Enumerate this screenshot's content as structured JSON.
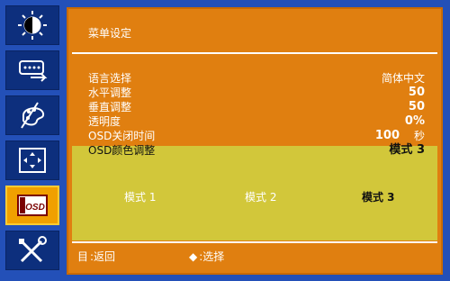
{
  "menu": {
    "title": "菜单设定",
    "rows": [
      {
        "label": "语言选择",
        "value": "简体中文"
      },
      {
        "label": "水平调整",
        "value": "50"
      },
      {
        "label": "垂直调整",
        "value": "50"
      },
      {
        "label": "透明度",
        "value": "0%"
      },
      {
        "label": "OSD关闭时间",
        "value": "100",
        "unit": "秒"
      },
      {
        "label": "OSD颜色调整",
        "value": "模式 3"
      }
    ],
    "modes": [
      "模式 1",
      "模式 2",
      "模式 3"
    ],
    "selected_mode": "模式 3"
  },
  "footer": {
    "back_glyph": "目",
    "back_label": ":返回",
    "select_glyph": "◆",
    "select_label": ":选择"
  },
  "sidebar": {
    "items": [
      {
        "icon": "brightness-icon"
      },
      {
        "icon": "input-source-icon"
      },
      {
        "icon": "color-palette-icon"
      },
      {
        "icon": "image-position-icon"
      },
      {
        "icon": "osd-settings-icon",
        "text": "OSD"
      },
      {
        "icon": "tools-icon"
      }
    ],
    "active_index": 4
  },
  "colors": {
    "background": "#2350b8",
    "panel": "#e07f10",
    "highlight": "#d2c73a",
    "active_tab": "#f0a000"
  }
}
